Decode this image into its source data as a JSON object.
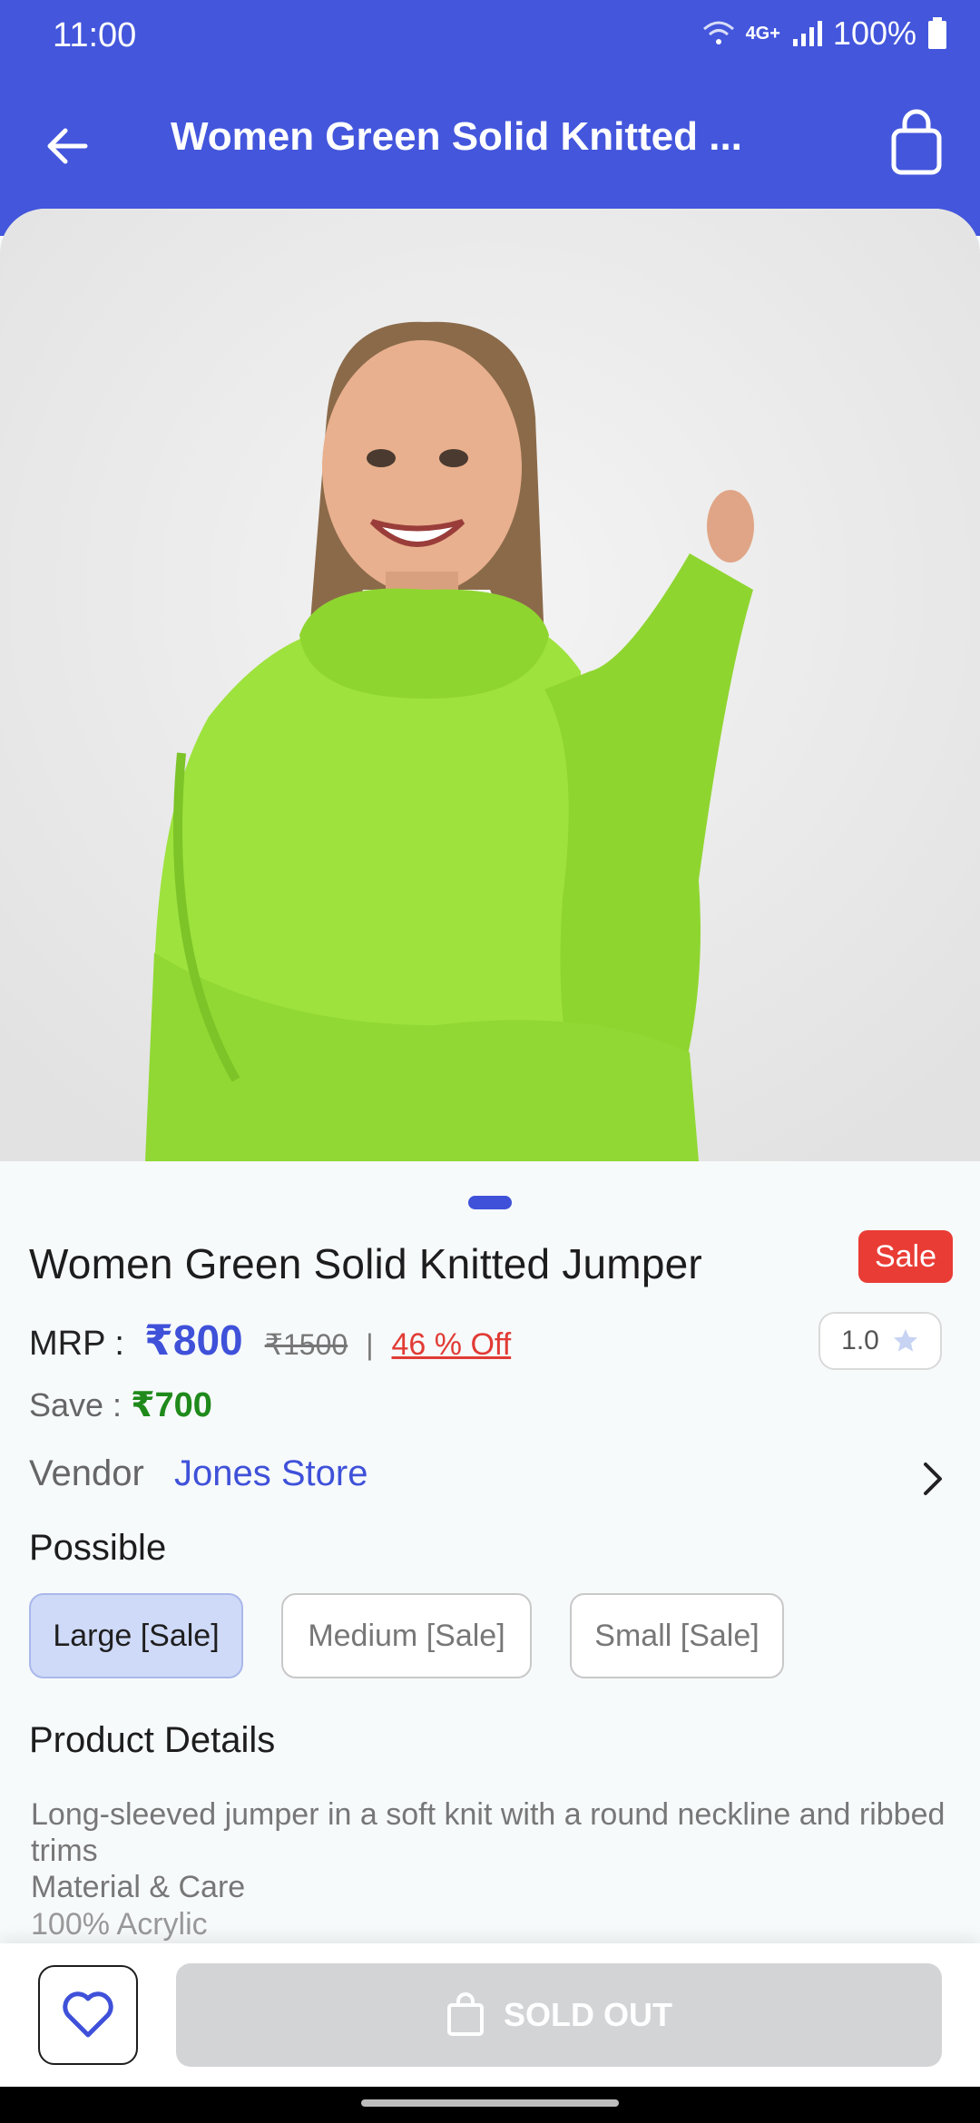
{
  "status_bar": {
    "time": "11:00",
    "network": "4G+",
    "battery": "100%"
  },
  "app_bar": {
    "title": "Women Green Solid Knitted ..."
  },
  "product": {
    "name": "Women Green Solid Knitted Jumper",
    "badge": "Sale",
    "mrp_label": "MRP :",
    "price": "₹800",
    "original_price": "₹1500",
    "separator": "|",
    "discount": "46 % Off",
    "rating": "1.0",
    "save_label": "Save :",
    "save_value": "₹700"
  },
  "vendor": {
    "label": "Vendor",
    "name": "Jones Store"
  },
  "sizes": {
    "heading": "Possible",
    "options": [
      "Large [Sale]",
      "Medium [Sale]",
      "Small [Sale]"
    ],
    "selected": "Large [Sale]"
  },
  "details": {
    "heading": "Product Details",
    "description": "Long-sleeved jumper in a soft knit with a round neckline and ribbed trims",
    "material_heading": "Material & Care",
    "cut_text": "100% Acrylic"
  },
  "bottom_bar": {
    "sold_out_label": "SOLD OUT"
  },
  "colors": {
    "primary": "#4356dc",
    "sale": "#e93c35",
    "save": "#1f8a1b",
    "disabled": "#d3d4d6"
  }
}
